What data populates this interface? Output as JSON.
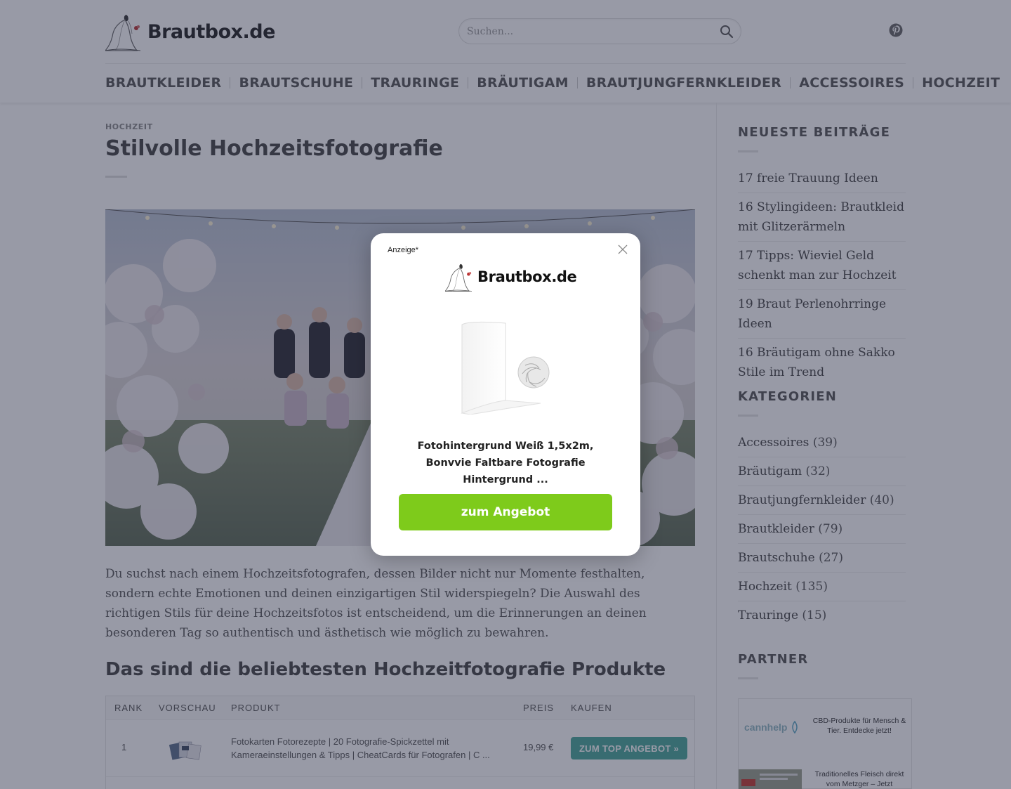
{
  "header": {
    "logo_text": "Brautbox.de",
    "search_placeholder": "Suchen...",
    "nav": [
      "Brautkleider",
      "Brautschuhe",
      "Trauringe",
      "Bräutigam",
      "Brautjungfernkleider",
      "Accessoires",
      "Hochzeit"
    ]
  },
  "article": {
    "category": "HOCHZEIT",
    "title": "Stilvolle Hochzeitsfotografie",
    "intro": "Du suchst nach einem Hochzeitsfotografen, dessen Bilder nicht nur Momente festhalten, sondern echte Emotionen und deinen einzigartigen Stil widerspiegeln? Die Auswahl des richtigen Stils für deine Hochzeitsfotos ist entscheidend, um die Erinnerungen an deinen besonderen Tag so authentisch und ästhetisch wie möglich zu bewahren.",
    "section_title": "Das sind die beliebtesten Hochzeitfotografie Produkte"
  },
  "product_table": {
    "headers": {
      "rank": "Rank",
      "preview": "Vorschau",
      "product": "Produkt",
      "price": "Preis",
      "buy": "Kaufen"
    },
    "rows": [
      {
        "rank": "1",
        "name": "Fotokarten Fotorezepte | 20 Fotografie-Spickzettel mit Kameraeinstellungen & Tipps | CheatCards für Fotografen | C ...",
        "price": "19,99 €",
        "button": "Zum Top Angebot »"
      }
    ]
  },
  "sidebar": {
    "recent_title": "Neueste Beiträge",
    "recent": [
      "17 freie Trauung Ideen",
      "16 Stylingideen: Brautkleid mit Glitzerärmeln",
      "17 Tipps: Wieviel Geld schenkt man zur Hochzeit",
      "19 Braut Perlenohrringe Ideen",
      "16 Bräutigam ohne Sakko Stile im Trend"
    ],
    "categories_title": "Kategorien",
    "categories": [
      {
        "name": "Accessoires",
        "count": "(39)"
      },
      {
        "name": "Bräutigam",
        "count": "(32)"
      },
      {
        "name": "Brautjungfernkleider",
        "count": "(40)"
      },
      {
        "name": "Brautkleider",
        "count": "(79)"
      },
      {
        "name": "Brautschuhe",
        "count": "(27)"
      },
      {
        "name": "Hochzeit",
        "count": "(135)"
      },
      {
        "name": "Trauringe",
        "count": "(15)"
      }
    ],
    "partner_title": "Partner",
    "partners": [
      {
        "logo_text": "cannhelp",
        "text": "CBD-Produkte für Mensch & Tier. Entdecke jetzt!"
      },
      {
        "logo_text": "",
        "text": "Traditionelles Fleisch direkt vom Metzger – Jetzt"
      }
    ]
  },
  "modal": {
    "ad_label": "Anzeige*",
    "logo_text": "Brautbox.de",
    "product_title": "Fotohintergrund Weiß 1,5x2m, Bonvvie Faltbare Fotografie Hintergrund ...",
    "button": "zum Angebot"
  },
  "colors": {
    "overlay": "#282c46",
    "cta_green": "#7ecb1b",
    "table_button": "#47a89a"
  }
}
